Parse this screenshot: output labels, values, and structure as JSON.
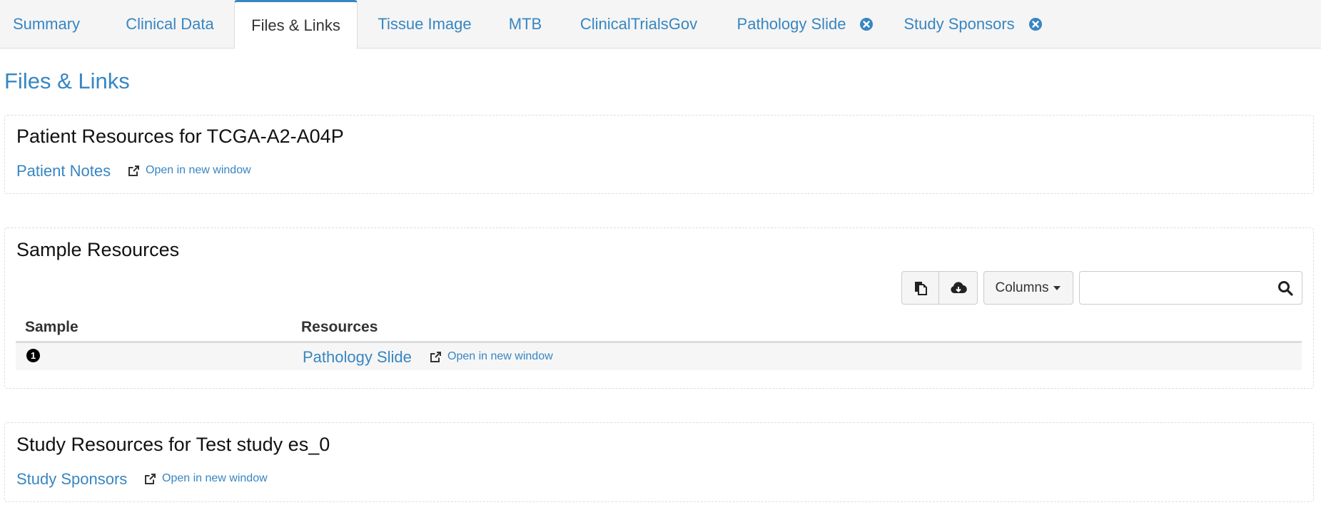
{
  "tabs": [
    {
      "label": "Summary",
      "active": false
    },
    {
      "label": "Clinical Data",
      "active": false
    },
    {
      "label": "Files & Links",
      "active": true
    },
    {
      "label": "Tissue Image",
      "active": false
    },
    {
      "label": "MTB",
      "active": false
    },
    {
      "label": "ClinicalTrialsGov",
      "active": false
    },
    {
      "label": "Pathology Slide",
      "active": false,
      "closable": true
    },
    {
      "label": "Study Sponsors",
      "active": false,
      "closable": true
    }
  ],
  "page_title": "Files & Links",
  "patient_resources": {
    "title": "Patient Resources for TCGA-A2-A04P",
    "link_label": "Patient Notes",
    "open_label": "Open in new window"
  },
  "sample_resources": {
    "title": "Sample Resources",
    "toolbar": {
      "copy_icon": "copy-icon",
      "download_icon": "cloud-download-icon",
      "columns_label": "Columns",
      "search_value": "",
      "search_placeholder": ""
    },
    "columns": [
      "Sample",
      "Resources"
    ],
    "rows": [
      {
        "sample_badge": "1",
        "resource_label": "Pathology Slide",
        "open_label": "Open in new window"
      }
    ]
  },
  "study_resources": {
    "title": "Study Resources for Test study es_0",
    "link_label": "Study Sponsors",
    "open_label": "Open in new window"
  },
  "colors": {
    "accent": "#3786c2",
    "tab_bar_bg": "#f5f5f5",
    "border": "#dddddd",
    "text": "#333333"
  }
}
